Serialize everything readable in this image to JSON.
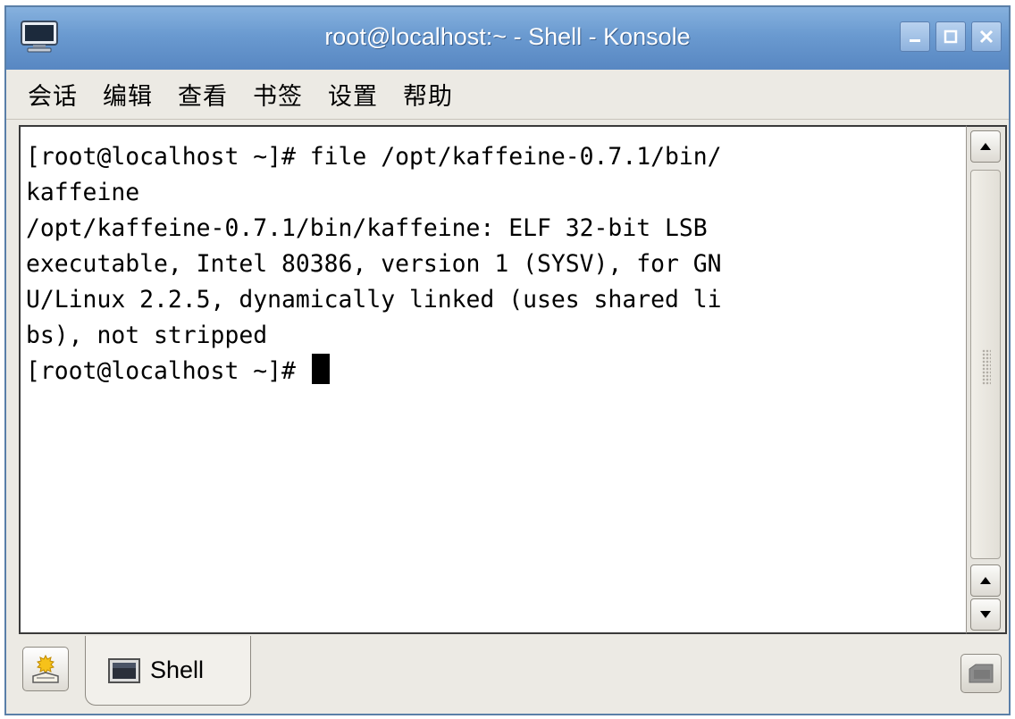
{
  "window": {
    "title": "root@localhost:~ - Shell - Konsole",
    "accent": "#6a9ad0"
  },
  "menubar": {
    "items": [
      {
        "label": "会话"
      },
      {
        "label": "编辑"
      },
      {
        "label": "查看"
      },
      {
        "label": "书签"
      },
      {
        "label": "设置"
      },
      {
        "label": "帮助"
      }
    ]
  },
  "terminal": {
    "lines": [
      "[root@localhost ~]# file /opt/kaffeine-0.7.1/bin/",
      "kaffeine",
      "/opt/kaffeine-0.7.1/bin/kaffeine: ELF 32-bit LSB",
      "executable, Intel 80386, version 1 (SYSV), for GN",
      "U/Linux 2.2.5, dynamically linked (uses shared li",
      "bs), not stripped"
    ],
    "prompt": "[root@localhost ~]# "
  },
  "tabs": [
    {
      "label": "Shell",
      "icon": "terminal-icon"
    }
  ],
  "icons": {
    "app": "konsole-monitor-icon",
    "new_session": "new-session-icon",
    "close_session": "close-session-icon"
  }
}
